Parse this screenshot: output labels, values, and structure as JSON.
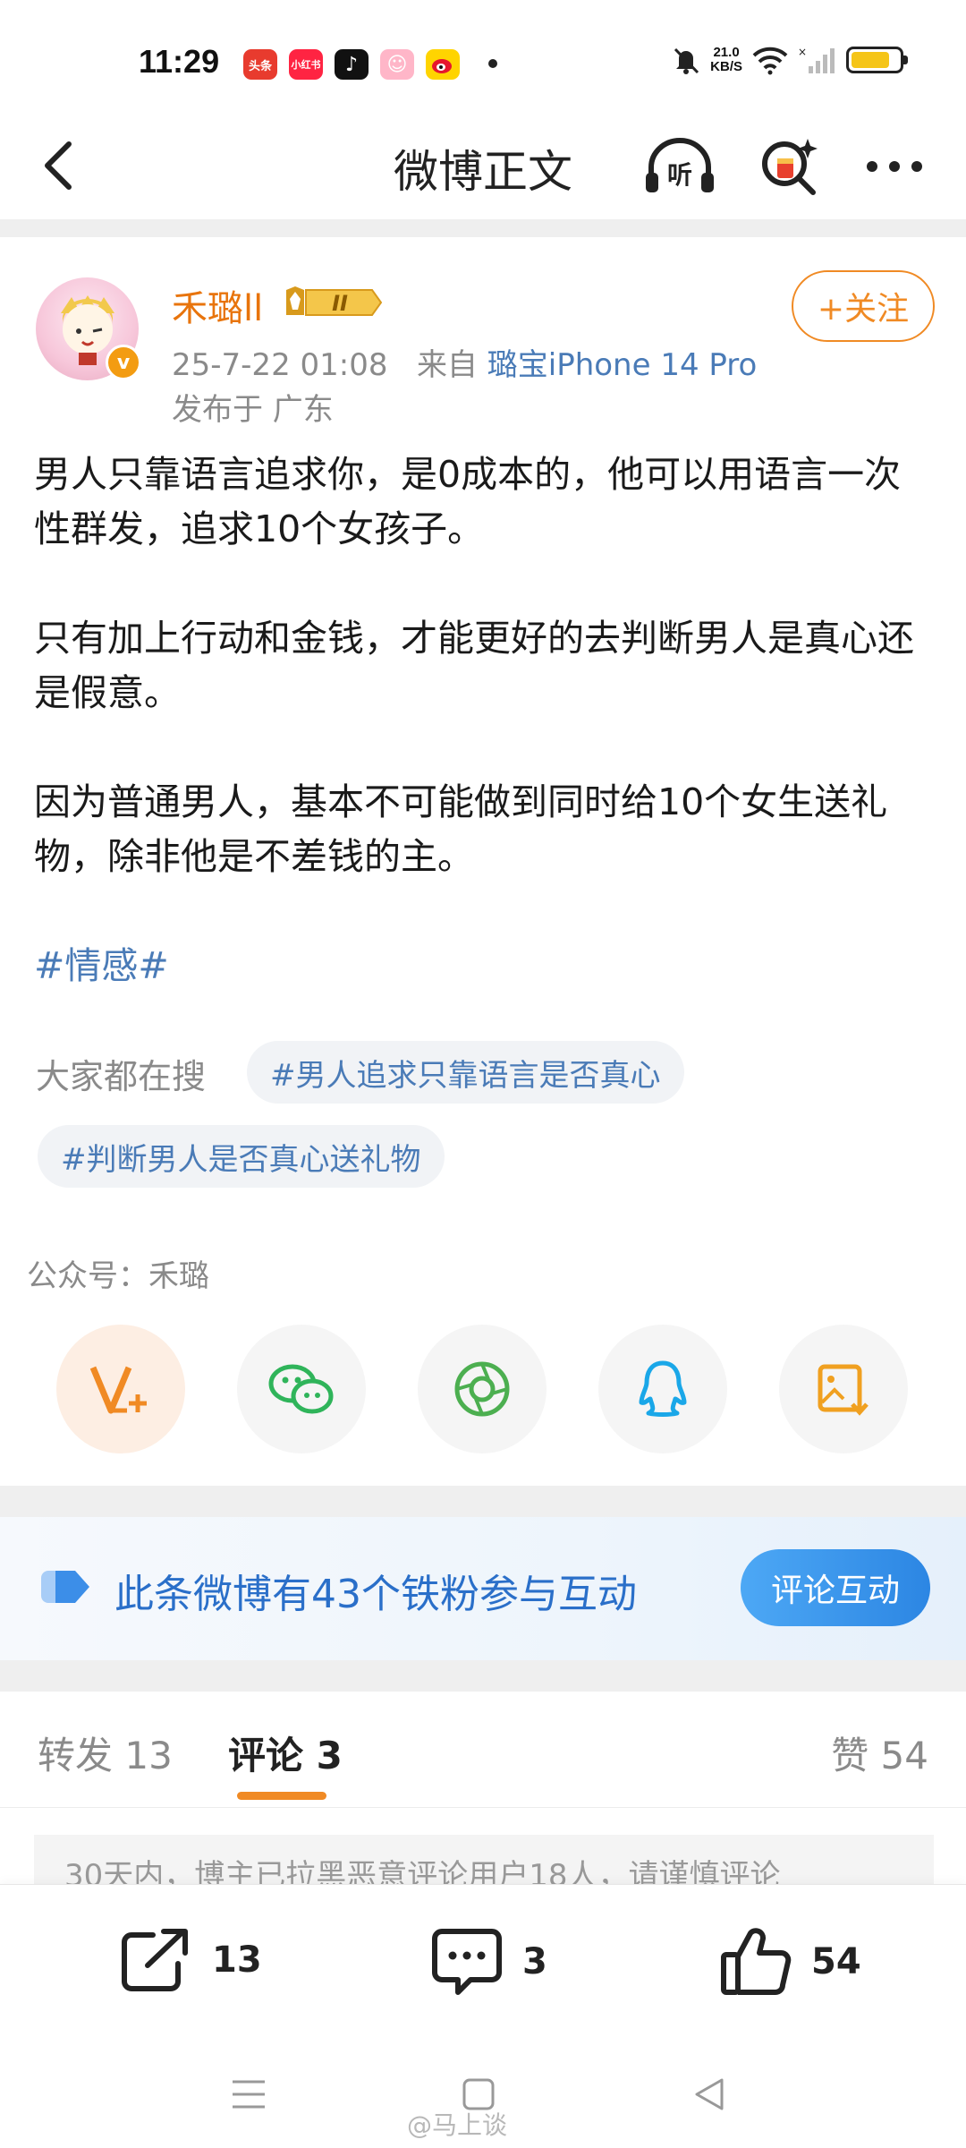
{
  "status_bar": {
    "time": "11:29",
    "apps": [
      "头条",
      "小红书"
    ],
    "net_speed_value": "21.0",
    "net_speed_unit": "KB/S",
    "battery_level": 0.8
  },
  "header": {
    "title": "微博正文",
    "listen_label": "听"
  },
  "author": {
    "name": "禾璐ll",
    "level": "II",
    "verified_badge": "v",
    "date": "25-7-22 01:08",
    "from_prefix": "来自",
    "source": "璐宝iPhone 14 Pro",
    "location": "发布于 广东",
    "follow_label": "+关注"
  },
  "post": {
    "paragraphs": [
      "男人只靠语言追求你，是0成本的，他可以用语言一次性群发，追求10个女孩子。",
      "只有加上行动和金钱，才能更好的去判断男人是真心还是假意。",
      "因为普通男人，基本不可能做到同时给10个女生送礼物，除非他是不差钱的主。"
    ],
    "hashtag": "#情感#"
  },
  "search": {
    "label": "大家都在搜",
    "chips": [
      "#男人追求只靠语言是否真心",
      "#判断男人是否真心送礼物"
    ]
  },
  "public_account": "公众号：禾璐",
  "share_icons": [
    "vplus-icon",
    "wechat-icon",
    "moments-icon",
    "qq-icon",
    "save-image-icon"
  ],
  "fans_banner": {
    "text": "此条微博有43个铁粉参与互动",
    "button": "评论互动"
  },
  "tabs": {
    "repost": "转发 13",
    "comments": "评论 3",
    "likes": "赞 54"
  },
  "notice": "30天内，博主已拉黑恶意评论用户18人，请谨慎评论",
  "actions": {
    "repost_count": "13",
    "comment_count": "3",
    "like_count": "54"
  },
  "watermark": "@马上谈",
  "colors": {
    "accent_orange": "#f08a24",
    "link_blue": "#4a7bb7",
    "banner_blue": "#2c86e3"
  }
}
